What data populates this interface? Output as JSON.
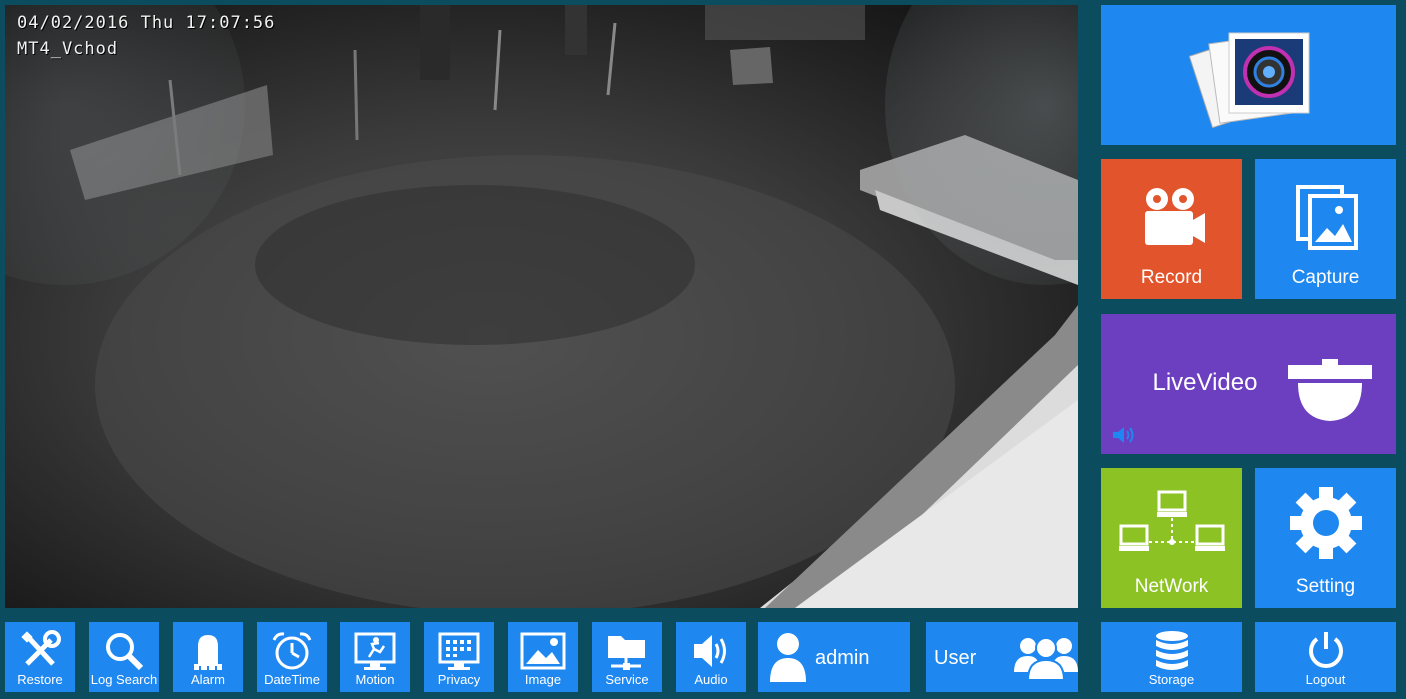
{
  "camera": {
    "datetime": "04/02/2016 Thu 17:07:56",
    "name": "MT4_Vchod"
  },
  "tiles": {
    "gallery_icon": "photo-stack-camera-icon",
    "record": "Record",
    "capture": "Capture",
    "livevideo": "LiveVideo",
    "network": "NetWork",
    "setting": "Setting",
    "storage": "Storage",
    "logout": "Logout"
  },
  "toolbar": {
    "restore": "Restore",
    "log_search": "Log Search",
    "alarm": "Alarm",
    "datetime": "DateTime",
    "motion": "Motion",
    "privacy": "Privacy",
    "image": "Image",
    "service": "Service",
    "audio": "Audio",
    "admin": "admin",
    "user": "User"
  },
  "colors": {
    "background": "#0b4d5e",
    "tile_blue": "#1e87f0",
    "record_orange": "#e2542b",
    "livevideo_purple": "#6b3fc0",
    "network_green": "#8cc224"
  }
}
